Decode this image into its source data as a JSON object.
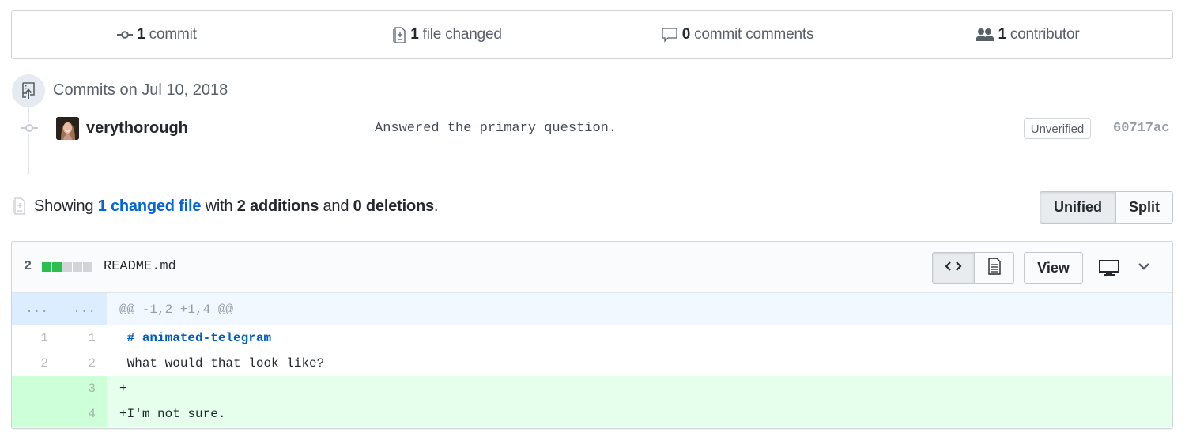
{
  "summary": {
    "commits": {
      "count": "1",
      "label": "commit",
      "icon": "git-commit-icon"
    },
    "files": {
      "count": "1",
      "label": "file changed",
      "icon": "file-diff-icon"
    },
    "comments": {
      "count": "0",
      "label": "commit comments",
      "icon": "comment-icon"
    },
    "contributors": {
      "count": "1",
      "label": "contributor",
      "icon": "people-icon"
    }
  },
  "commits_group": {
    "date_label": "Commits on Jul 10, 2018",
    "icon": "repo-push-icon",
    "commits": [
      {
        "author": "verythorough",
        "message": "Answered the primary question.",
        "verification": "Unverified",
        "sha": "60717ac"
      }
    ]
  },
  "diff_summary": {
    "prefix": "Showing",
    "changed_files_link": "1 changed file",
    "with": "with",
    "additions": "2 additions",
    "and": "and",
    "deletions": "0 deletions",
    "suffix": ".",
    "view_modes": {
      "unified": "Unified",
      "split": "Split",
      "selected": "Unified"
    }
  },
  "file": {
    "diffstat_count": "2",
    "diffstat_blocks": [
      "added",
      "added",
      "neutral",
      "neutral",
      "neutral"
    ],
    "colors": {
      "added": "#2cbe4e",
      "neutral": "#d1d5da"
    },
    "name": "README.md",
    "view_button": "View",
    "selected_display": "source",
    "hunk": {
      "old_marker": "...",
      "new_marker": "...",
      "header": "@@ -1,2 +1,4 @@"
    },
    "lines": [
      {
        "type": "context",
        "old": "1",
        "new": "1",
        "prefix": " ",
        "text": "# animated-telegram",
        "style": "heading"
      },
      {
        "type": "context",
        "old": "2",
        "new": "2",
        "prefix": " ",
        "text": "What would that look like?",
        "style": "plain"
      },
      {
        "type": "addition",
        "old": "",
        "new": "3",
        "prefix": "+",
        "text": "",
        "style": "plain"
      },
      {
        "type": "addition",
        "old": "",
        "new": "4",
        "prefix": "+",
        "text": "I'm not sure.",
        "style": "plain"
      }
    ]
  }
}
